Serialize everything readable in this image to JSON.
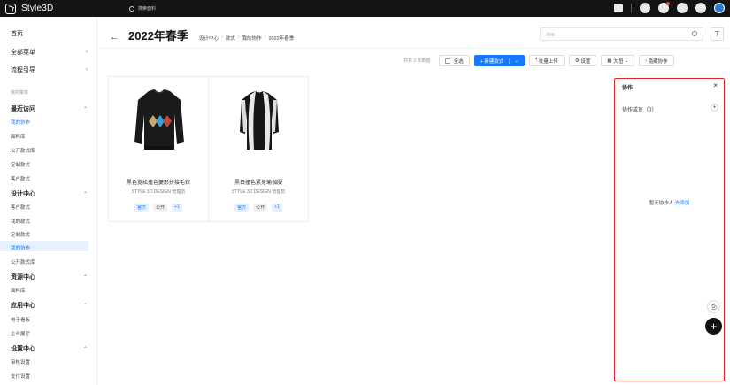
{
  "brand": {
    "name": "Style3D"
  },
  "topbar": {
    "search_placeholder": "搜索面料"
  },
  "sidebar": {
    "home": "首页",
    "all_menu": "全部菜单",
    "guide": "流程引导",
    "my_menu_caption": "我的菜单",
    "recent": {
      "label": "最近访问",
      "items": [
        "我的协作",
        "面料库",
        "公开款式库",
        "定制款式",
        "客户款式"
      ]
    },
    "design_center": {
      "label": "设计中心",
      "items": [
        "客户款式",
        "我的款式",
        "定制款式",
        "我的协作",
        "公开款式库"
      ]
    },
    "resource_center": {
      "label": "资源中心",
      "items": [
        "面料库"
      ]
    },
    "app_center": {
      "label": "应用中心",
      "items": [
        "电子看板",
        "企业展厅"
      ]
    },
    "settings_center": {
      "label": "设置中心",
      "items": [
        "审核设置",
        "支付设置"
      ]
    },
    "active_item": "我的协作"
  },
  "header": {
    "back": "←",
    "title": "2022年春季",
    "breadcrumb": [
      "设计中心",
      "款式",
      "我的协作",
      "2022年春季"
    ],
    "search_placeholder": "搜索"
  },
  "toolbar": {
    "count_text": "共有 2 条数据",
    "select_all": "全选",
    "new_style": "+ 新建款式",
    "batch_upload": "批量上传",
    "settings": "设置",
    "view": "大图",
    "hide_collab": "隐藏协作"
  },
  "cards": [
    {
      "name": "黑色宽松撞色菱形拼接毛衣",
      "owner": "STYLE 3D DESIGN 管理员",
      "tags": [
        "官方",
        "公开",
        "+1"
      ]
    },
    {
      "name": "黑白撞色紧身瑜伽服",
      "owner": "STYLE 3D DESIGN 管理员",
      "tags": [
        "官方",
        "公开",
        "+1"
      ]
    }
  ],
  "collab_panel": {
    "title": "协作",
    "close": "×",
    "members": "协作成员（0）",
    "add": "+",
    "empty_text": "暂无协作人,",
    "empty_link": "去添加"
  },
  "colors": {
    "accent": "#1677ff",
    "highlight_border": "#e0262c",
    "topbar": "#141414"
  }
}
